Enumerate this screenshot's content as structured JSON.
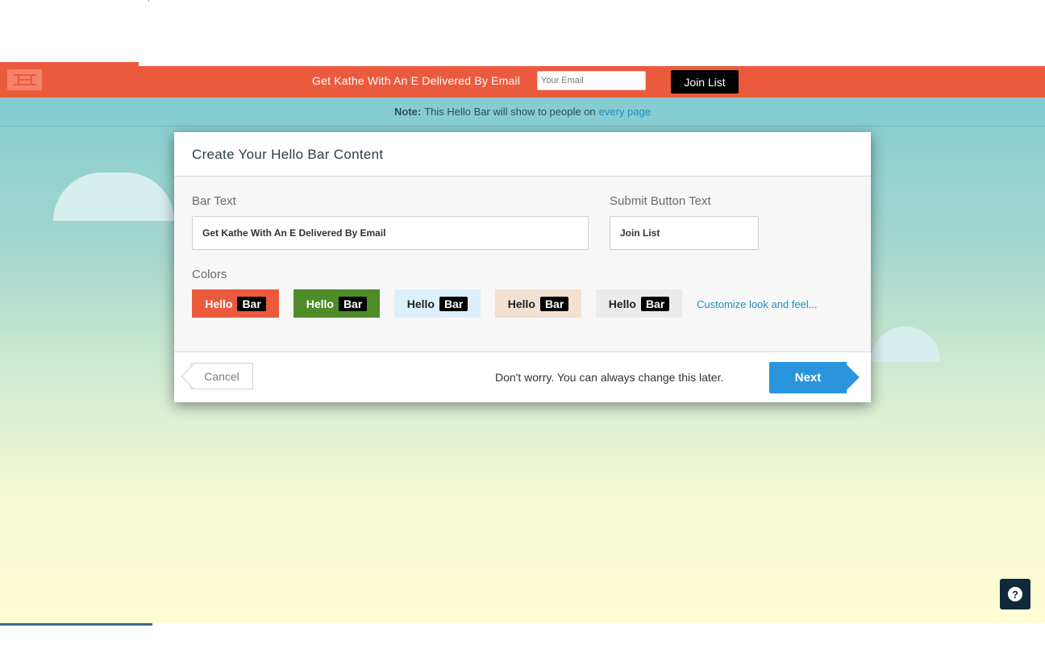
{
  "hello_bar": {
    "text": "Get Kathe With An E Delivered By Email",
    "email_placeholder": "Your Email",
    "button_label": "Join List",
    "color": "#ec5a3e"
  },
  "note": {
    "prefix": "Note:",
    "text": "This Hello Bar will show to people on",
    "link": "every page"
  },
  "modal": {
    "title": "Create Your Hello Bar Content",
    "bar_text_label": "Bar Text",
    "bar_text_value": "Get Kathe With An E Delivered By Email",
    "submit_label": "Submit Button Text",
    "submit_value": "Join List",
    "colors_label": "Colors",
    "swatches": [
      {
        "hello": "Hello",
        "bar": "Bar",
        "bg": "#ec5a3e",
        "fg": "#ffffff"
      },
      {
        "hello": "Hello",
        "bar": "Bar",
        "bg": "#4d8c26",
        "fg": "#ffffff"
      },
      {
        "hello": "Hello",
        "bar": "Bar",
        "bg": "#dcf0fc",
        "fg": "#222222"
      },
      {
        "hello": "Hello",
        "bar": "Bar",
        "bg": "#f2e0d1",
        "fg": "#222222"
      },
      {
        "hello": "Hello",
        "bar": "Bar",
        "bg": "#ebebeb",
        "fg": "#222222"
      }
    ],
    "customize_link": "Customize look and feel...",
    "cancel_label": "Cancel",
    "footer_note": "Don't worry. You can always change this later.",
    "next_label": "Next"
  },
  "help": {
    "icon": "question-icon"
  }
}
